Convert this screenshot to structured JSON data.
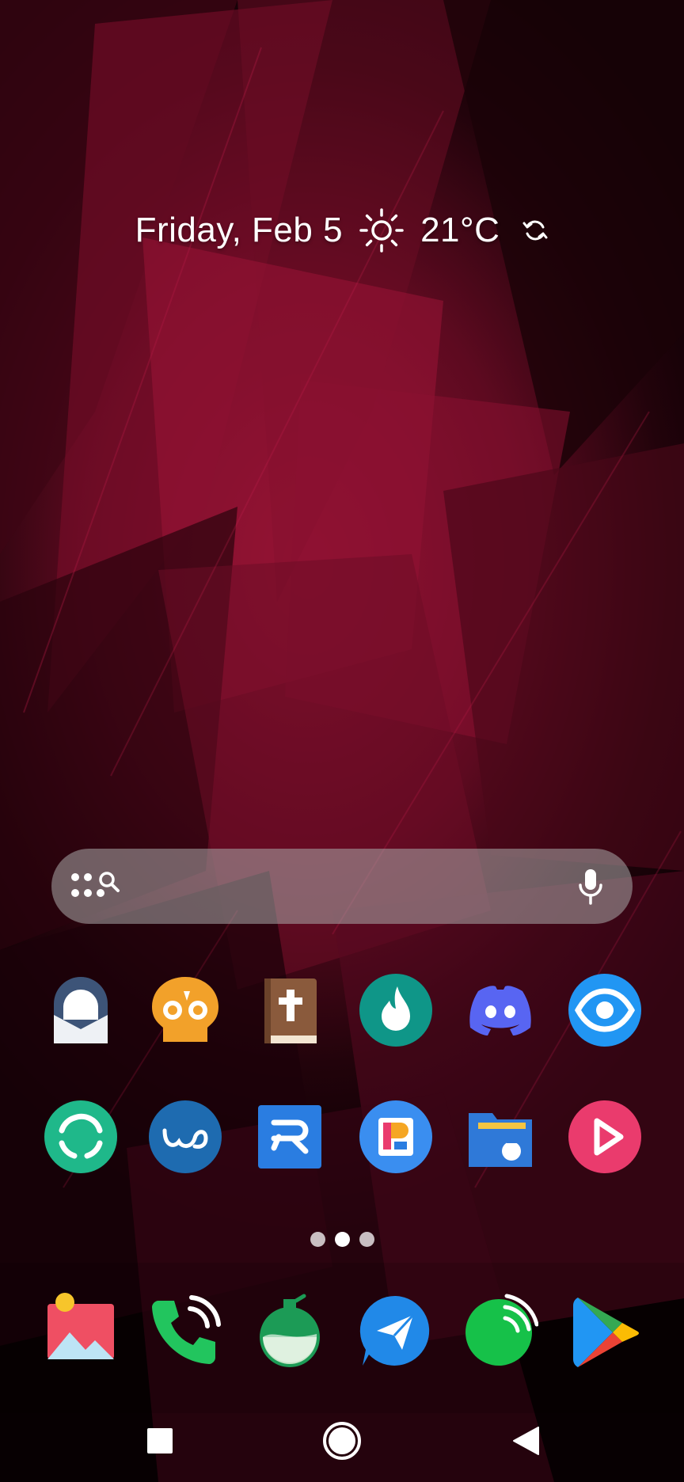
{
  "glance": {
    "date": "Friday, Feb 5",
    "temperature": "21°C",
    "weather_icon": "sun-icon",
    "refresh_icon": "refresh-icon"
  },
  "search": {
    "placeholder": "",
    "left_icon": "app-search-icon",
    "right_icon": "microphone-icon"
  },
  "apps_row1": [
    {
      "name": "mail-app",
      "icon": "envelope-icon",
      "color": "#3d5478"
    },
    {
      "name": "skull-app",
      "icon": "skull-icon",
      "color": "#f2a12a"
    },
    {
      "name": "bible-app",
      "icon": "book-cross-icon",
      "color": "#8a5a3c"
    },
    {
      "name": "tinder-app",
      "icon": "flame-icon",
      "color": "#0f9688"
    },
    {
      "name": "discord-app",
      "icon": "discord-icon",
      "color": "#5865f2"
    },
    {
      "name": "eye-app",
      "icon": "eye-icon",
      "color": "#2196f3"
    }
  ],
  "apps_row2": [
    {
      "name": "element-app",
      "icon": "element-icon",
      "color": "#1fb88a"
    },
    {
      "name": "wave-app",
      "icon": "wave-icon",
      "color": "#1e6bb0"
    },
    {
      "name": "r-app",
      "icon": "r-letter-icon",
      "color": "#2a7de1"
    },
    {
      "name": "p-app",
      "icon": "p-letter-icon",
      "color": "#3a8ef0"
    },
    {
      "name": "files-app",
      "icon": "folder-icon",
      "color": "#2f79d8"
    },
    {
      "name": "video-player-app",
      "icon": "play-icon",
      "color": "#ea3b6d"
    }
  ],
  "page_indicator": {
    "count": 3,
    "active": 2
  },
  "dock": [
    {
      "name": "gallery-app",
      "icon": "gallery-icon",
      "color": "#ef4f63"
    },
    {
      "name": "phone-app",
      "icon": "phone-icon",
      "color": "#22c55e"
    },
    {
      "name": "potion-app",
      "icon": "flask-icon",
      "color": "#1c9b56"
    },
    {
      "name": "telegram-app",
      "icon": "paper-plane-icon",
      "color": "#2189e8"
    },
    {
      "name": "podcast-app",
      "icon": "podcast-icon",
      "color": "#16c149"
    },
    {
      "name": "play-store-app",
      "icon": "play-store-icon",
      "color": "#34a853"
    }
  ],
  "navbar": {
    "recents_icon": "square-icon",
    "home_icon": "circle-icon",
    "back_icon": "triangle-back-icon"
  }
}
